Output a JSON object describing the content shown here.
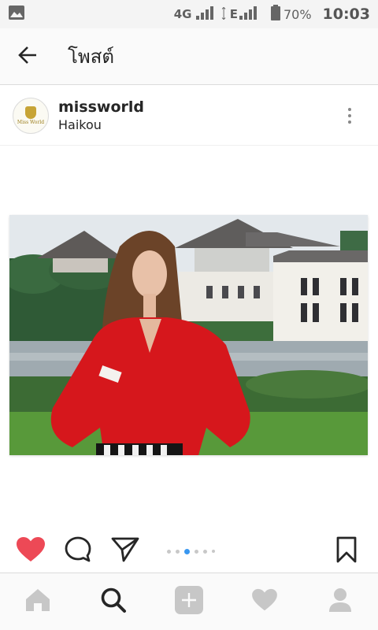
{
  "status_bar": {
    "network": "4G",
    "lte": "E",
    "battery": "70%",
    "time": "10:03",
    "icons": [
      "image-icon",
      "signal-icon",
      "battery-icon"
    ]
  },
  "app_bar": {
    "title": "โพสต์",
    "back_icon": "arrow-left-icon"
  },
  "post": {
    "username": "missworld",
    "location": "Haikou",
    "avatar_text": "Miss World",
    "more_icon": "more-vertical-icon",
    "carousel": {
      "count": 6,
      "active_index": 2
    }
  },
  "actions": {
    "icons": [
      "heart-filled-icon",
      "comment-icon",
      "share-icon",
      "bookmark-icon"
    ]
  },
  "bottom_nav": {
    "items": [
      "home-icon",
      "search-icon",
      "add-icon",
      "activity-icon",
      "profile-icon"
    ],
    "active": "search-icon"
  },
  "colors": {
    "like_red": "#ed4956",
    "active_dot": "#3897f0",
    "inactive_icon": "#c7c7c7",
    "dark_icon": "#262626"
  }
}
